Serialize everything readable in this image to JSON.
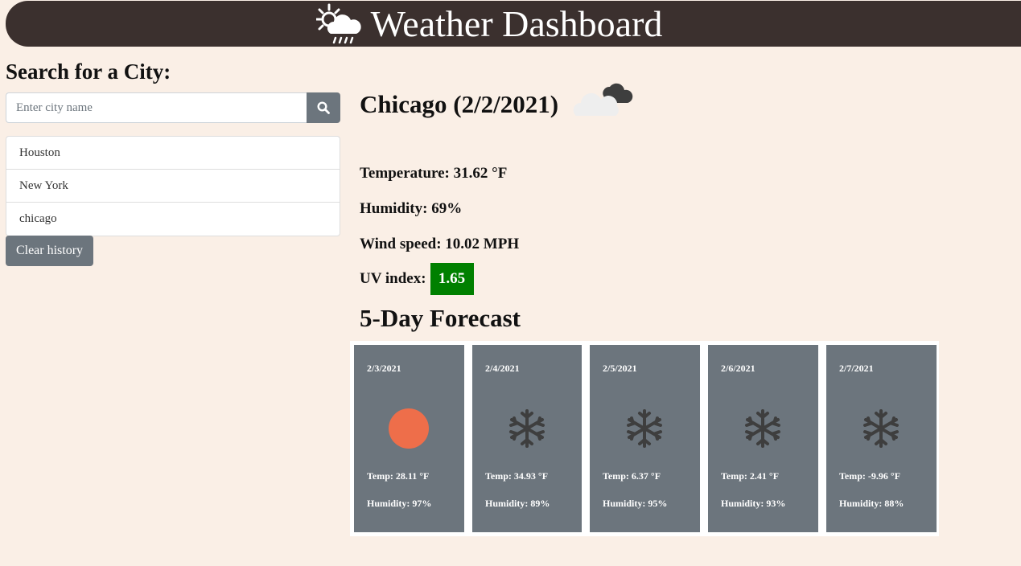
{
  "header": {
    "title": "Weather Dashboard",
    "icon": "sun-cloud-rain-icon"
  },
  "search": {
    "heading": "Search for a City:",
    "placeholder": "Enter city name",
    "button_icon": "search-icon"
  },
  "history": {
    "items": [
      "Houston",
      "New York",
      "chicago"
    ],
    "clear_label": "Clear history"
  },
  "current": {
    "title": "Chicago (2/2/2021)",
    "icon": "broken-clouds-icon",
    "temperature": "Temperature: 31.62 °F",
    "humidity": "Humidity: 69%",
    "wind": "Wind speed: 10.02 MPH",
    "uv_label": "UV index:",
    "uv_value": "1.65",
    "uv_color": "#008000"
  },
  "forecast": {
    "heading": "5-Day Forecast",
    "days": [
      {
        "date": "2/3/2021",
        "icon": "sun-icon",
        "temp": "Temp: 28.11 °F",
        "humidity": "Humidity: 97%"
      },
      {
        "date": "2/4/2021",
        "icon": "snowflake-icon",
        "temp": "Temp: 34.93 °F",
        "humidity": "Humidity: 89%"
      },
      {
        "date": "2/5/2021",
        "icon": "snowflake-icon",
        "temp": "Temp: 6.37 °F",
        "humidity": "Humidity: 95%"
      },
      {
        "date": "2/6/2021",
        "icon": "snowflake-icon",
        "temp": "Temp: 2.41 °F",
        "humidity": "Humidity: 93%"
      },
      {
        "date": "2/7/2021",
        "icon": "snowflake-icon",
        "temp": "Temp: -9.96 °F",
        "humidity": "Humidity: 88%"
      }
    ]
  },
  "colors": {
    "page_background": "#faefe6",
    "header_background": "#3b302e",
    "card_background": "#6c757d",
    "button_background": "#6c757d",
    "sun": "#ee6e4a",
    "snowflake": "#3e3e3e"
  }
}
